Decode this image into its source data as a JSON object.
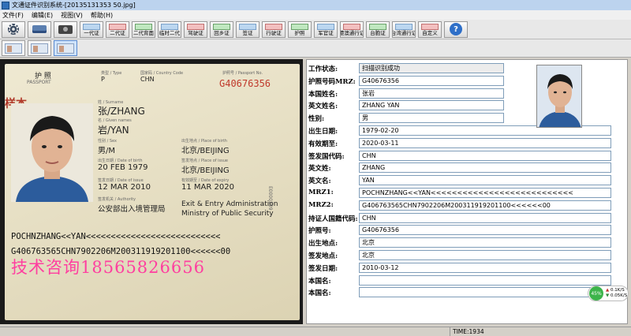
{
  "window": {
    "title": "文通证件识别系统-[20135131353 50.jpg]"
  },
  "menu": [
    "文件(F)",
    "编辑(E)",
    "视图(V)",
    "帮助(H)"
  ],
  "toolbar": {
    "tools": [
      {
        "icon": "settings-gear-icon"
      },
      {
        "icon": "scan-icon"
      },
      {
        "icon": "camera-icon"
      }
    ],
    "card_buttons": [
      "一代证",
      "二代证",
      "二代背面",
      "临时二代",
      "驾驶证",
      "回乡证",
      "签证",
      "行驶证",
      "护照",
      "军官证",
      "港澳通行证",
      "台胞证",
      "台湾通行证",
      "自定义"
    ],
    "help_icon": "help-icon",
    "help_label": "?"
  },
  "thumbs": [
    {
      "icon": "image-thumb-icon"
    },
    {
      "icon": "image-thumb-icon"
    },
    {
      "icon": "image-thumb-icon"
    }
  ],
  "passport_image": {
    "header_cn": "护 照",
    "header_en": "PASSPORT",
    "type_label": "类型 / Type",
    "type_value": "P",
    "country_label": "国家码 / Country Code",
    "country_value": "CHN",
    "passno_label": "护照号 / Passport No.",
    "passno_value": "G40676356",
    "stamp_text": "样本",
    "surname_label": "姓 / Surname",
    "surname_value": "张/ZHANG",
    "given_label": "名 / Given names",
    "given_value": "岩/YAN",
    "sex_label": "性别 / Sex",
    "sex_value": "男/M",
    "pob_label": "出生地点 / Place of birth",
    "pob_value": "北京/BEIJING",
    "dob_label": "出生日期 / Date of birth",
    "dob_value": "20 FEB 1979",
    "poi_label": "签发地点 / Place of issue",
    "poi_value": "北京/BEIJING",
    "doi_label": "签发日期 / Date of issue",
    "doi_value": "12 MAR 2010",
    "doe_label": "有效期至 / Date of expiry",
    "doe_value": "11 MAR 2020",
    "auth_label": "签发机关 / Authority",
    "auth_value": "公安部出入境管理局",
    "auth_en1": "Exit & Entry Administration",
    "auth_en2": "Ministry of Public Security",
    "serial": "E0000209",
    "mrz1": "POCHNZHANG<<YAN<<<<<<<<<<<<<<<<<<<<<<<<<<<",
    "mrz2": "G406763565CHN7902206M200311919201100<<<<<<00",
    "watermark": "技术咨询18565826656"
  },
  "form": {
    "fields": [
      {
        "label": "工作状态:",
        "value": "扫描识别成功"
      },
      {
        "label": "护照号码MRZ:",
        "value": "G40676356"
      },
      {
        "label": "本国姓名:",
        "value": "张岩"
      },
      {
        "label": "英文姓名:",
        "value": "ZHANG  YAN"
      },
      {
        "label": "性别:",
        "value": "男"
      },
      {
        "label": "出生日期:",
        "value": "1979-02-20"
      },
      {
        "label": "有效期至:",
        "value": "2020-03-11"
      },
      {
        "label": "签发国代码:",
        "value": "CHN"
      },
      {
        "label": "英文姓:",
        "value": "ZHANG"
      },
      {
        "label": "英文名:",
        "value": "YAN"
      },
      {
        "label": "MRZ1:",
        "value": "POCHNZHANG<<YAN<<<<<<<<<<<<<<<<<<<<<<<<<<<"
      },
      {
        "label": "MRZ2:",
        "value": "G406763565CHN7902206M200311919201100<<<<<<00"
      },
      {
        "label": "持证人国籍代码:",
        "value": "CHN"
      },
      {
        "label": "护照号:",
        "value": "G40676356"
      },
      {
        "label": "出生地点:",
        "value": "北京"
      },
      {
        "label": "签发地点:",
        "value": "北京"
      },
      {
        "label": "签发日期:",
        "value": "2010-03-12"
      },
      {
        "label": "本国名:",
        "value": ""
      },
      {
        "label": "本国名:",
        "value": ""
      }
    ]
  },
  "network": {
    "percent": "45%",
    "up": "0.1K/S",
    "down": "0.05K/S"
  },
  "statusbar": {
    "time": "TIME:1934"
  }
}
